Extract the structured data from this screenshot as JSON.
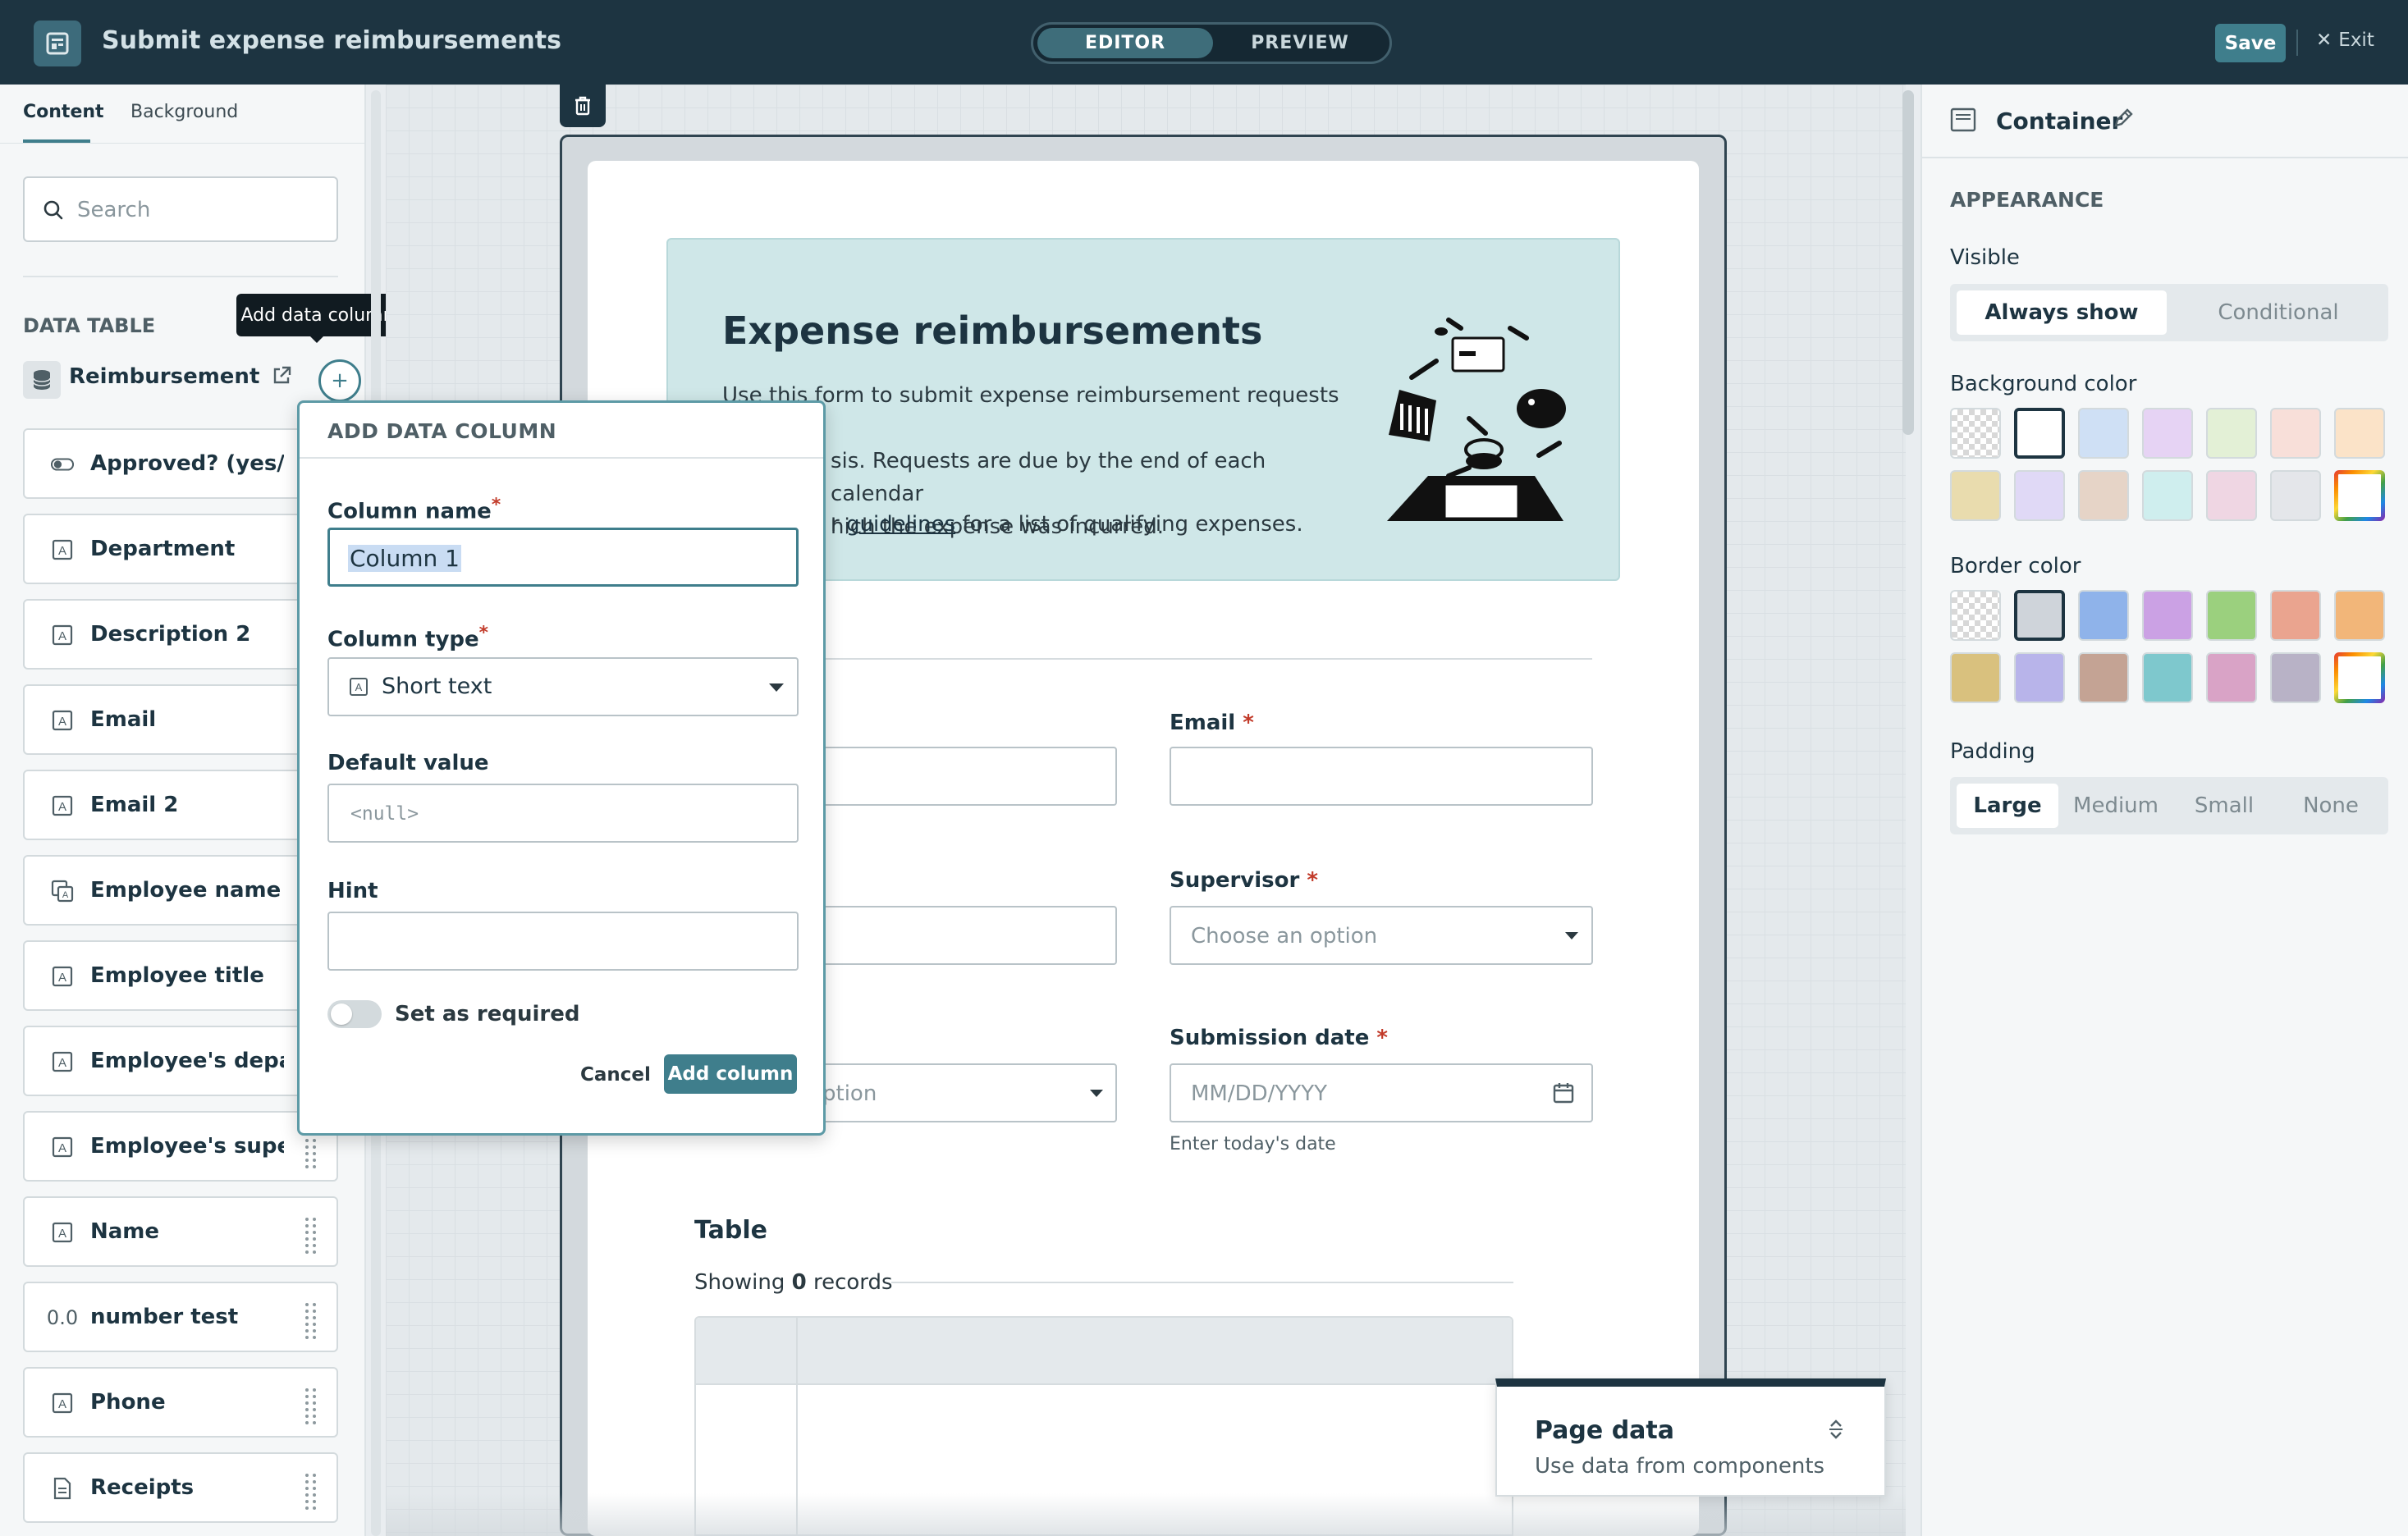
{
  "header": {
    "title": "Submit expense reimbursements",
    "mode_editor": "EDITOR",
    "mode_preview": "PREVIEW",
    "save_label": "Save",
    "exit_label": "Exit"
  },
  "left_panel": {
    "tabs": [
      "Content",
      "Background"
    ],
    "search_placeholder": "Search",
    "section_title": "DATA TABLE",
    "table_name": "Reimbursement r...",
    "tooltip": "Add data column",
    "columns": [
      {
        "label": "Approved? (yes/no)",
        "icon": "toggle-icon"
      },
      {
        "label": "Department",
        "icon": "text-field-icon"
      },
      {
        "label": "Description 2",
        "icon": "text-field-icon"
      },
      {
        "label": "Email",
        "icon": "text-field-icon"
      },
      {
        "label": "Email 2",
        "icon": "text-field-icon"
      },
      {
        "label": "Employee name",
        "icon": "linked-record-icon"
      },
      {
        "label": "Employee title",
        "icon": "text-field-icon"
      },
      {
        "label": "Employee's depa...",
        "icon": "text-field-icon"
      },
      {
        "label": "Employee's supe...",
        "icon": "text-field-icon"
      },
      {
        "label": "Name",
        "icon": "text-field-icon"
      },
      {
        "label": "number test",
        "icon": "number-icon",
        "icon_text": "0.0"
      },
      {
        "label": "Phone",
        "icon": "text-field-icon"
      },
      {
        "label": "Receipts",
        "icon": "file-icon"
      }
    ]
  },
  "popover": {
    "title": "ADD DATA COLUMN",
    "column_name_label": "Column name",
    "column_name_value": "Column 1",
    "column_type_label": "Column type",
    "column_type_value": "Short text",
    "default_label": "Default value",
    "default_placeholder": "<null>",
    "hint_label": "Hint",
    "hint_value": "",
    "required_label": "Set as required",
    "required_on": false,
    "cancel_label": "Cancel",
    "add_label": "Add column"
  },
  "form": {
    "banner_title": "Expense reimbursements",
    "banner_text": "Use this form to submit expense reimbursement requests on a ...sis. Requests are due by the end of each calendar ...which the expense was incurred.",
    "banner_line1": "Use this form to submit expense reimbursement requests on a",
    "banner_line2": "sis. Requests are due by the end of each calendar",
    "banner_line3": "hich the expense was incurred.",
    "banner_text2_prefix": "r ",
    "banner_link": "guidelines",
    "banner_text2_suffix": " for a list of qualifying expenses.",
    "email_label": "Email",
    "supervisor_label": "Supervisor",
    "supervisor_placeholder": "Choose an option",
    "submission_label": "Submission date",
    "submission_placeholder": "MM/DD/YYYY",
    "submission_hint": "Enter today's date",
    "left_select_fragment": "ption",
    "table_title": "Table",
    "records_prefix": "Showing ",
    "records_count": "0",
    "records_suffix": " records"
  },
  "page_data_panel": {
    "title": "Page data",
    "subtitle": "Use data from components"
  },
  "right_panel": {
    "title": "Container",
    "appearance_title": "APPEARANCE",
    "visible_label": "Visible",
    "visible_options": [
      "Always show",
      "Conditional"
    ],
    "visible_selected": "Always show",
    "background_label": "Background color",
    "background_colors": [
      "transparent",
      "#ffffff",
      "#cfe0f5",
      "#e6d3f4",
      "#e3f0d6",
      "#f8dfd9",
      "#fbe3c8",
      "#e9dcae",
      "#e0d9f6",
      "#e6d4c7",
      "#cfeeee",
      "#efd6e3",
      "#e4e6ea",
      "rainbow"
    ],
    "background_selected": 1,
    "border_label": "Border color",
    "border_colors": [
      "transparent",
      "#cfd4da",
      "#8fb3ea",
      "#cba1e4",
      "#9bd07e",
      "#eaa48f",
      "#f2b679",
      "#d9c17e",
      "#b8b4ea",
      "#c4a394",
      "#7ec8cd",
      "#d9a3c6",
      "#b8b2c6",
      "rainbow"
    ],
    "border_selected": 1,
    "padding_label": "Padding",
    "padding_options": [
      "Large",
      "Medium",
      "Small",
      "None"
    ],
    "padding_selected": "Large"
  },
  "colors": {
    "topbar": "#1d3441",
    "accent": "#3f7e8c",
    "banner": "#cfe7e8",
    "required": "#c23b2a"
  }
}
